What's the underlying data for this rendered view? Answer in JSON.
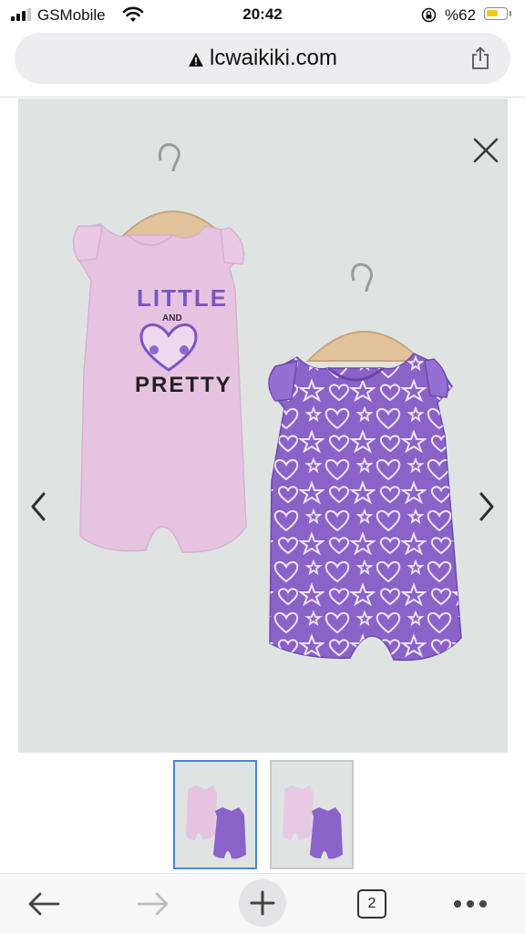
{
  "status_bar": {
    "carrier": "GSMobile",
    "time": "20:42",
    "battery_percent": "%62",
    "battery_level": 0.62,
    "battery_color": "#f3c623",
    "signal_bars": 3,
    "icons": [
      "signal-icon",
      "wifi-icon",
      "orientation-lock-icon",
      "battery-icon"
    ]
  },
  "browser": {
    "url": "lcwaikiki.com",
    "url_icon": "warning-icon",
    "share_icon": "share-icon"
  },
  "viewer": {
    "close_icon": "close-icon",
    "prev_icon": "chevron-left-icon",
    "next_icon": "chevron-right-icon",
    "background_color": "#dfe4e3",
    "product_image": {
      "left_romper_print": [
        "LITTLE",
        "AND",
        "PRETTY"
      ],
      "left_romper_color": "#e6c4e1",
      "right_romper_color": "#8a62c8"
    }
  },
  "thumbnails": {
    "count": 2,
    "selected_index": 0,
    "selected_border_color": "#4a84d6"
  },
  "toolbar": {
    "back_icon": "arrow-left-icon",
    "forward_icon": "arrow-right-icon",
    "new_tab_icon": "plus-icon",
    "tab_count": "2",
    "menu_icon": "more-horizontal-icon"
  }
}
